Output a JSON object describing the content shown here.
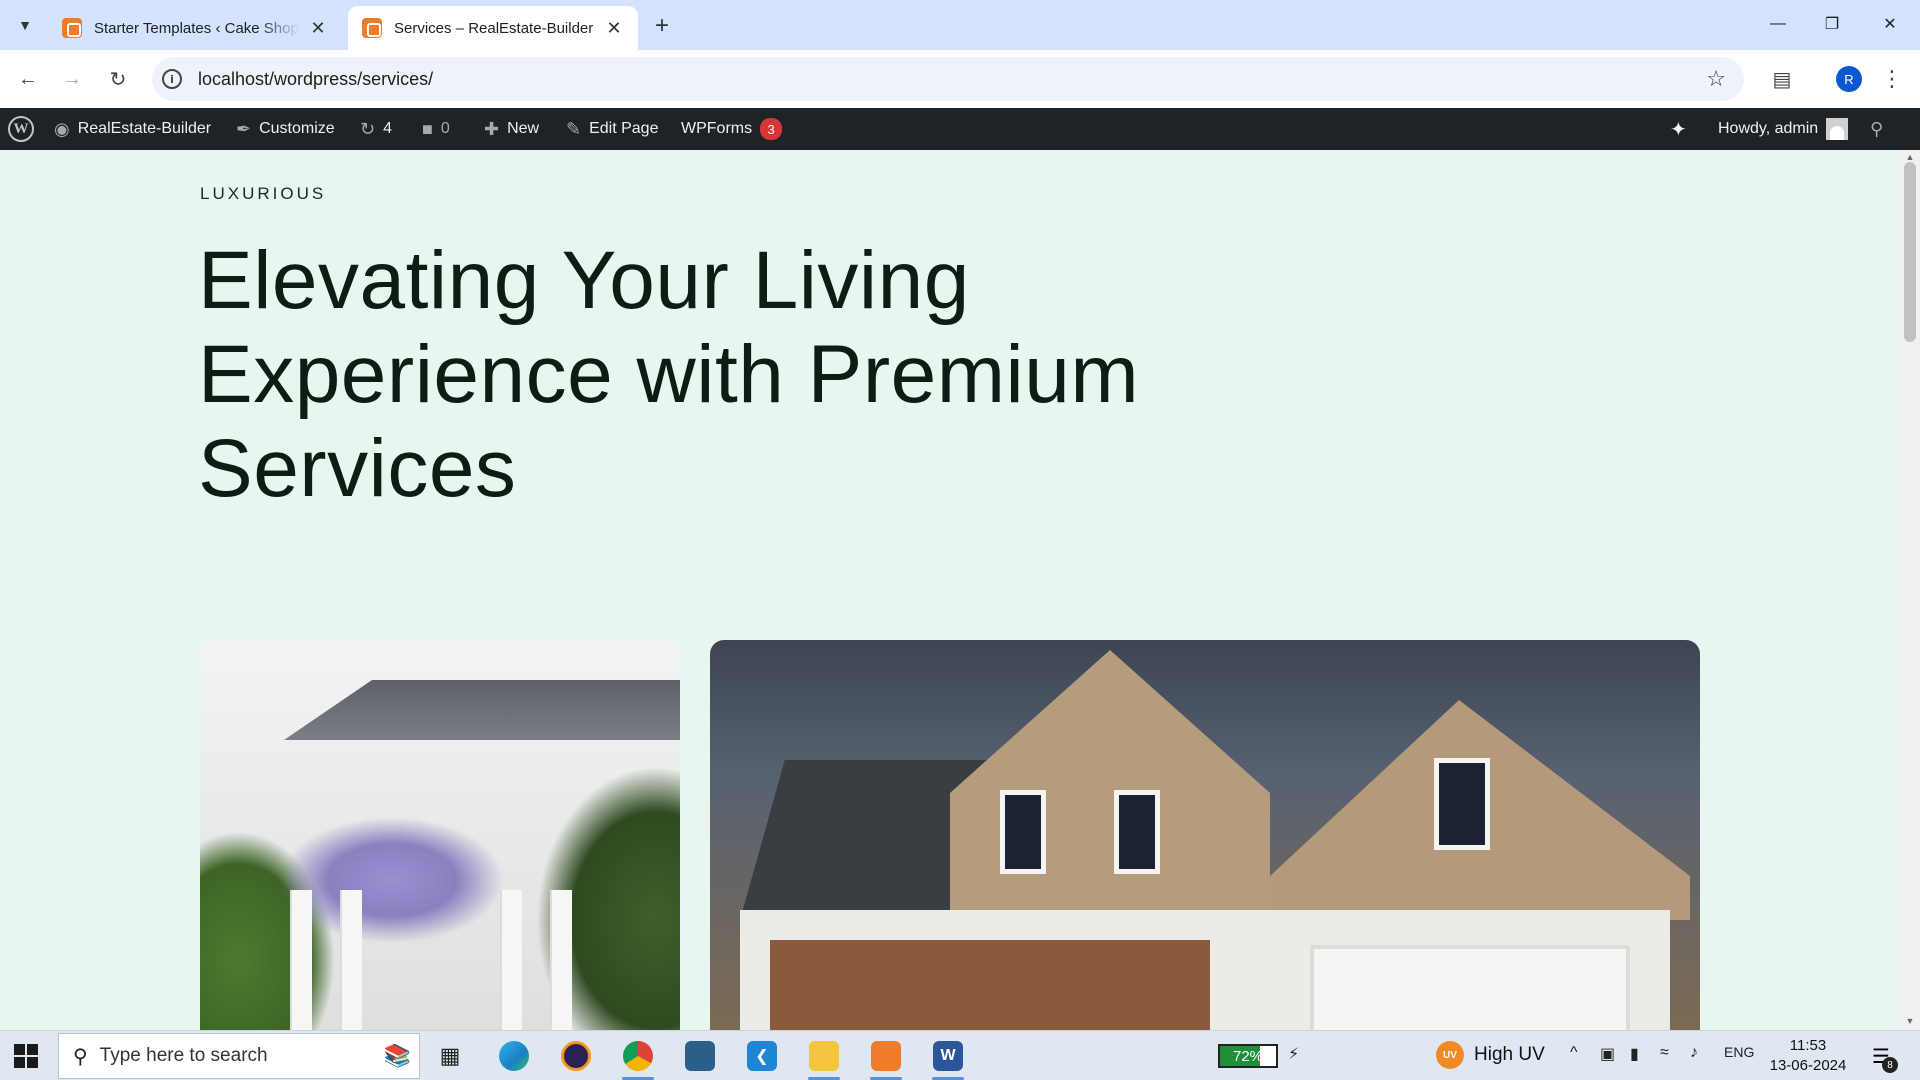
{
  "browser": {
    "tabs": [
      {
        "title": "Starter Templates ‹ Cake Shop — WordPress",
        "active": false
      },
      {
        "title": "Services – RealEstate-Builder",
        "active": true
      }
    ],
    "url": "localhost/wordpress/services/",
    "profile_initial": "R"
  },
  "adminbar": {
    "site_name": "RealEstate-Builder",
    "customize": "Customize",
    "updates_count": "4",
    "comments_count": "0",
    "new_label": "New",
    "edit_page": "Edit Page",
    "wpforms_label": "WPForms",
    "wpforms_badge": "3",
    "howdy": "Howdy, admin"
  },
  "page": {
    "eyebrow": "LUXURIOUS",
    "title_line1": "Elevating Your Living",
    "title_line2": "Experience with Premium",
    "title_line3": "Services"
  },
  "taskbar": {
    "search_placeholder": "Type here to search",
    "battery_percent": "72%",
    "battery_level": 0.72,
    "weather_text": "High UV",
    "uv_label": "UV",
    "language": "ENG",
    "time": "11:53",
    "date": "13-06-2024",
    "notification_count": "8"
  },
  "colors": {
    "page_bg": "#e8f6ef",
    "adminbar_bg": "#1d2327",
    "tabstrip_bg": "#d3e3fd",
    "accent": "#0b57d0",
    "badge": "#d63638"
  }
}
